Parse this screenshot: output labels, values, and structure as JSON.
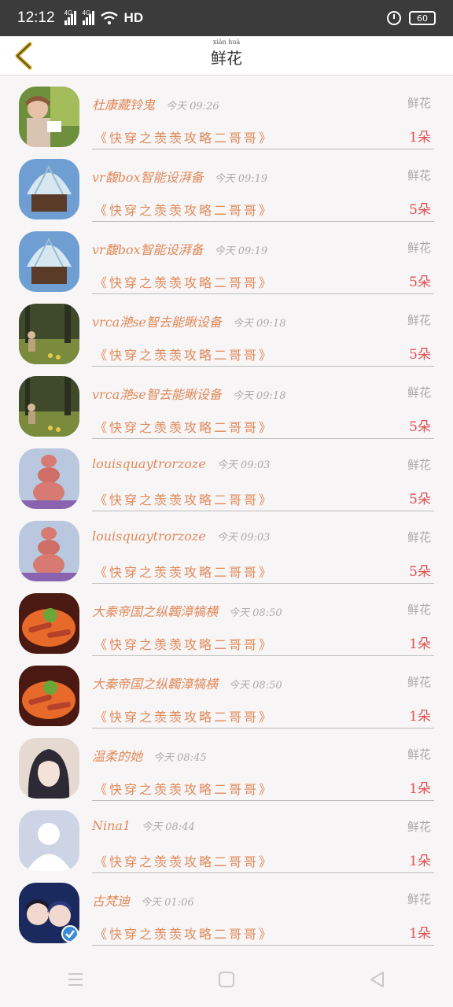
{
  "status": {
    "time": "12:12",
    "net1": "4G",
    "net2": "4G",
    "hd": "HD",
    "battery": "60"
  },
  "header": {
    "title": "鲜花",
    "title_pinyin": "xiān huā"
  },
  "rows": [
    {
      "name": "杜康藏铃鬼",
      "time": "今天 09:26",
      "gift": "鲜花",
      "msg": "《快穿之羡羡攻略二哥哥》",
      "count": "1朵"
    },
    {
      "name": "vr馥box智能设湃备",
      "time": "今天 09:19",
      "gift": "鲜花",
      "msg": "《快穿之羡羡攻略二哥哥》",
      "count": "5朵"
    },
    {
      "name": "vr馥box智能设湃备",
      "time": "今天 09:19",
      "gift": "鲜花",
      "msg": "《快穿之羡羡攻略二哥哥》",
      "count": "5朵"
    },
    {
      "name": "vrca滟se智去能瞅设备",
      "time": "今天 09:18",
      "gift": "鲜花",
      "msg": "《快穿之羡羡攻略二哥哥》",
      "count": "5朵"
    },
    {
      "name": "vrca滟se智去能瞅设备",
      "time": "今天 09:18",
      "gift": "鲜花",
      "msg": "《快穿之羡羡攻略二哥哥》",
      "count": "5朵"
    },
    {
      "name": "louisquaytrorzoze",
      "time": "今天 09:03",
      "gift": "鲜花",
      "msg": "《快穿之羡羡攻略二哥哥》",
      "count": "5朵"
    },
    {
      "name": "louisquaytrorzoze",
      "time": "今天 09:03",
      "gift": "鲜花",
      "msg": "《快穿之羡羡攻略二哥哥》",
      "count": "5朵"
    },
    {
      "name": "大秦帝国之纵韣漳犒横",
      "time": "今天 08:50",
      "gift": "鲜花",
      "msg": "《快穿之羡羡攻略二哥哥》",
      "count": "1朵"
    },
    {
      "name": "大秦帝国之纵韣漳犒横",
      "time": "今天 08:50",
      "gift": "鲜花",
      "msg": "《快穿之羡羡攻略二哥哥》",
      "count": "1朵"
    },
    {
      "name": "温柔的她",
      "time": "今天 08:45",
      "gift": "鲜花",
      "msg": "《快穿之羡羡攻略二哥哥》",
      "count": "1朵"
    },
    {
      "name": "Nina1",
      "time": "今天 08:44",
      "gift": "鲜花",
      "msg": "《快穿之羡羡攻略二哥哥》",
      "count": "1朵"
    },
    {
      "name": "古梵迪",
      "time": "今天 01:06",
      "gift": "鲜花",
      "msg": "《快穿之羡羡攻略二哥哥》",
      "count": "1朵"
    }
  ],
  "avatars": [
    "woman-reading",
    "cupcake-shell",
    "cupcake-shell",
    "child-forest",
    "child-forest",
    "pig-stack",
    "pig-stack",
    "food-plate",
    "food-plate",
    "anime-girl",
    "default-user",
    "anime-couple"
  ],
  "icons": [
    "back-arrow-icon",
    "menu-icon",
    "home-icon",
    "back-triangle-icon"
  ],
  "colors": {
    "accent": "#e08a5a",
    "count": "#e05050",
    "back_arrow": "#c9a21b"
  }
}
